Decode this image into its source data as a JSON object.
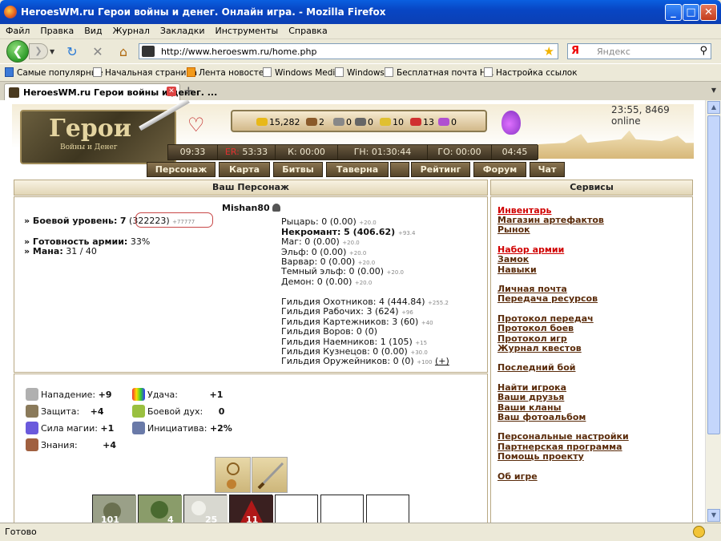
{
  "window": {
    "title": "HeroesWM.ru Герои войны и денег. Онлайн игра. - Mozilla Firefox"
  },
  "menu": [
    "Файл",
    "Правка",
    "Вид",
    "Журнал",
    "Закладки",
    "Инструменты",
    "Справка"
  ],
  "nav": {
    "url": "http://www.heroeswm.ru/home.php",
    "search_engine": "Я",
    "search_placeholder": "Яндекс"
  },
  "bookmarks": [
    "Самые популярные",
    "Начальная страница",
    "Лента новостей",
    "Windows Media",
    "Windows",
    "Бесплатная почта H...",
    "Настройка ссылок"
  ],
  "tab": {
    "label": "HeroesWM.ru Герои войны и денег. ..."
  },
  "status": {
    "text": "Готово"
  },
  "game": {
    "logo_title": "Герои",
    "logo_subtitle": "Войны и Денег",
    "online": "23:55, 8469 online",
    "resources": [
      "15,282",
      "2",
      "0",
      "0",
      "10",
      "13",
      "0"
    ],
    "timers": [
      {
        "prefix": "",
        "text": "09:33"
      },
      {
        "prefix": "ER:",
        "text": " 53:33"
      },
      {
        "prefix": "",
        "text": "К: 00:00"
      },
      {
        "prefix": "",
        "text": "ГН: 01:30:44"
      },
      {
        "prefix": "",
        "text": "ГО: 00:00"
      },
      {
        "prefix": "",
        "text": "04:45"
      }
    ],
    "nav": [
      "Персонаж",
      "Карта",
      "Битвы",
      "Таверна",
      "",
      "Рейтинг",
      "Форум",
      "Чат"
    ]
  },
  "character": {
    "header": "Ваш Персонаж",
    "name": "Mishan80",
    "level_label": "» Боевой уровень:",
    "level": "7",
    "exp": "(322223)",
    "exp_plus": "+77777",
    "readiness_label": "» Готовность армии:",
    "readiness": "33%",
    "mana_label": "» Мана:",
    "mana": "31 / 40",
    "factions": [
      {
        "label": "Рыцарь: 0 (0.00)",
        "bonus": "+20.0",
        "bold": false
      },
      {
        "label": "Некромант: 5 (406.62)",
        "bonus": "+93.4",
        "bold": true
      },
      {
        "label": "Маг: 0 (0.00)",
        "bonus": "+20.0",
        "bold": false
      },
      {
        "label": "Эльф: 0 (0.00)",
        "bonus": "+20.0",
        "bold": false
      },
      {
        "label": "Варвар: 0 (0.00)",
        "bonus": "+20.0",
        "bold": false
      },
      {
        "label": "Темный эльф: 0 (0.00)",
        "bonus": "+20.0",
        "bold": false
      },
      {
        "label": "Демон: 0 (0.00)",
        "bonus": "+20.0",
        "bold": false
      }
    ],
    "guilds": [
      {
        "label": "Гильдия Охотников: 4 (444.84)",
        "bonus": "+255.2"
      },
      {
        "label": "Гильдия Рабочих: 3 (624)",
        "bonus": "+96"
      },
      {
        "label": "Гильдия Картежников: 3 (60)",
        "bonus": "+40"
      },
      {
        "label": "Гильдия Воров: 0 (0)",
        "bonus": ""
      },
      {
        "label": "Гильдия Наемников: 1 (105)",
        "bonus": "+15"
      },
      {
        "label": "Гильдия Кузнецов: 0 (0.00)",
        "bonus": "+30.0"
      },
      {
        "label": "Гильдия Оружейников: 0 (0)",
        "bonus": "+100"
      }
    ],
    "plus_link": "(+)",
    "stats": [
      {
        "label": "Нападение:",
        "value": "+9"
      },
      {
        "label": "Защита:",
        "value": "+4"
      },
      {
        "label": "Сила магии:",
        "value": "+1"
      },
      {
        "label": "Знания:",
        "value": "+4"
      }
    ],
    "stats2": [
      {
        "label": "Удача:",
        "value": "+1"
      },
      {
        "label": "Боевой дух:",
        "value": "0"
      },
      {
        "label": "Инициатива:",
        "value": "+2%"
      }
    ],
    "army_counts": [
      "101",
      "4",
      "25",
      "11"
    ]
  },
  "services": {
    "header": "Сервисы",
    "links": [
      {
        "label": "Инвентарь",
        "red": true
      },
      {
        "label": "Магазин артефактов",
        "red": false
      },
      {
        "label": "Рынок",
        "red": false
      },
      {
        "label": "Набор армии",
        "red": true
      },
      {
        "label": "Замок",
        "red": false
      },
      {
        "label": "Навыки",
        "red": false
      },
      {
        "label": "Личная почта",
        "red": false
      },
      {
        "label": "Передача ресурсов",
        "red": false
      },
      {
        "label": "Протокол передач",
        "red": false
      },
      {
        "label": "Протокол боев",
        "red": false
      },
      {
        "label": "Протокол игр",
        "red": false
      },
      {
        "label": "Журнал квестов",
        "red": false
      },
      {
        "label": "Последний бой",
        "red": false
      },
      {
        "label": "Найти игрока",
        "red": false
      },
      {
        "label": "Ваши друзья",
        "red": false
      },
      {
        "label": "Ваши кланы",
        "red": false
      },
      {
        "label": "Ваш фотоальбом",
        "red": false
      },
      {
        "label": "Персональные настройки",
        "red": false
      },
      {
        "label": "Партнерская программа",
        "red": false
      },
      {
        "label": "Помощь проекту",
        "red": false
      },
      {
        "label": "Об игре",
        "red": false
      }
    ]
  }
}
